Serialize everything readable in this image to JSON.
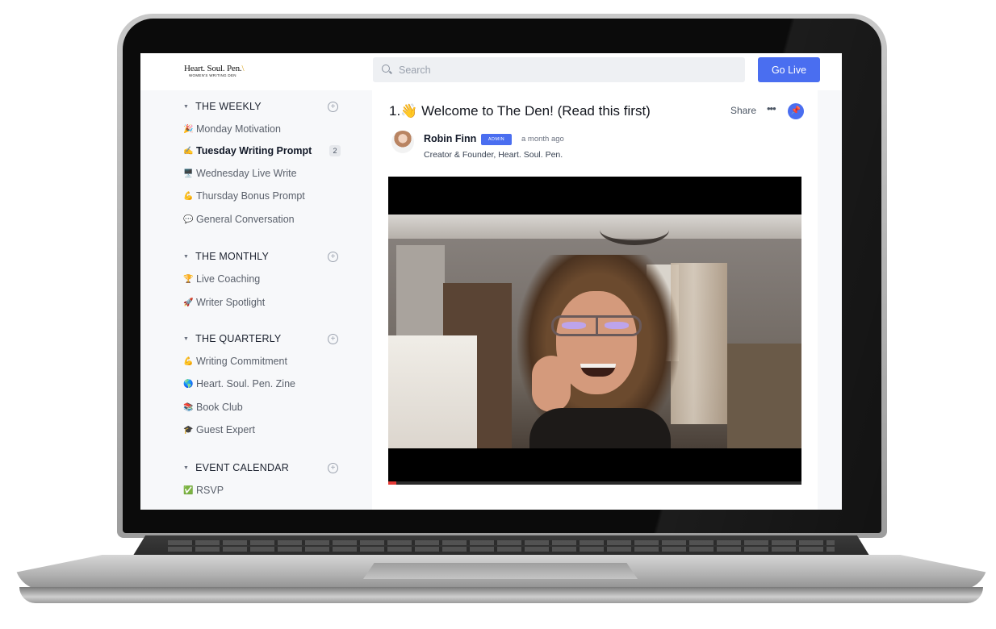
{
  "header": {
    "logo_title": "Heart. Soul. Pen.",
    "logo_subtitle": "WOMEN'S WRITING DEN",
    "search_placeholder": "Search",
    "go_live_label": "Go Live"
  },
  "sidebar": {
    "sections": [
      {
        "title": "THE WEEKLY",
        "items": [
          {
            "emoji": "🎉",
            "label": "Monday Motivation"
          },
          {
            "emoji": "✍️",
            "label": "Tuesday Writing Prompt",
            "active": true,
            "count": "2"
          },
          {
            "emoji": "🖥️",
            "label": "Wednesday Live Write"
          },
          {
            "emoji": "💪",
            "label": "Thursday Bonus Prompt"
          },
          {
            "emoji": "💬",
            "label": "General Conversation"
          }
        ]
      },
      {
        "title": "THE MONTHLY",
        "items": [
          {
            "emoji": "🏆",
            "label": "Live Coaching"
          },
          {
            "emoji": "🚀",
            "label": "Writer Spotlight"
          }
        ]
      },
      {
        "title": "THE QUARTERLY",
        "items": [
          {
            "emoji": "💪",
            "label": "Writing Commitment"
          },
          {
            "emoji": "🌎",
            "label": "Heart. Soul. Pen. Zine"
          },
          {
            "emoji": "📚",
            "label": "Book Club"
          },
          {
            "emoji": "🎓",
            "label": "Guest Expert"
          }
        ]
      },
      {
        "title": "EVENT CALENDAR",
        "items": [
          {
            "emoji": "✅",
            "label": "RSVP"
          }
        ]
      }
    ]
  },
  "post": {
    "title": "1.👋 Welcome to The Den! (Read this first)",
    "share_label": "Share",
    "author_name": "Robin Finn",
    "author_badge": "ADMIN",
    "timestamp": "a month ago",
    "author_role": "Creator & Founder, Heart. Soul. Pen.",
    "video_progress_percent": 2
  },
  "icons": {
    "search": "search-icon",
    "more": "more-horizontal-icon",
    "pin": "pin-icon",
    "add_section": "plus-circle-icon",
    "collapse": "caret-down-icon"
  },
  "colors": {
    "accent": "#4a6ef0",
    "sidebar_bg": "#f7f8fa",
    "progress": "#e53935"
  }
}
